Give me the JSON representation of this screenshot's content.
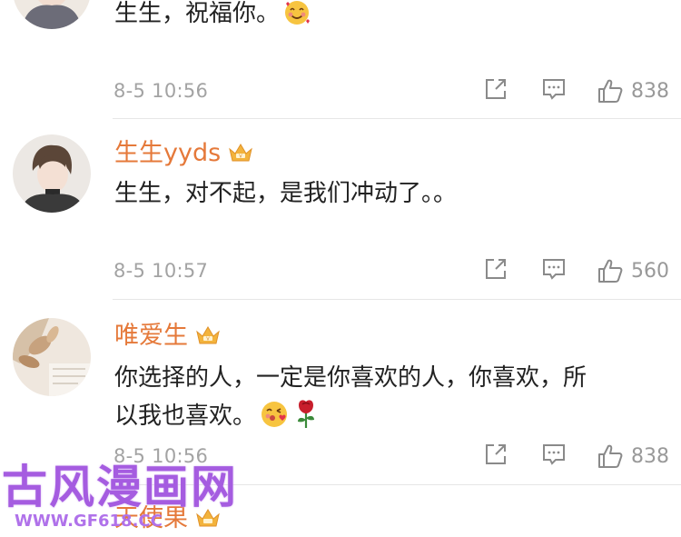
{
  "comments": [
    {
      "username": "",
      "text": "生生，祝福你。",
      "emoji": "smiling-face-with-hearts",
      "time": "8-5 10:56",
      "likes": "838"
    },
    {
      "username": "生生yyds",
      "text": "生生，对不起，是我们冲动了。。",
      "time": "8-5 10:57",
      "likes": "560"
    },
    {
      "username": "唯爱生",
      "text_line1": "你选择的人，一定是你喜欢的人，你喜欢，所",
      "text_line2": "以我也喜欢。",
      "emoji": [
        "face-blowing-kiss",
        "rose"
      ],
      "time": "8-5 10:56",
      "likes": "838"
    },
    {
      "username": "天使果"
    }
  ],
  "watermark": {
    "brand": "古风漫画网",
    "url": "WWW.GF618.CC"
  },
  "colors": {
    "username": "#e5793a",
    "text": "#222222",
    "meta": "#a3a3a3",
    "divider": "#e6e6e6",
    "watermark": "#a55ce0"
  }
}
